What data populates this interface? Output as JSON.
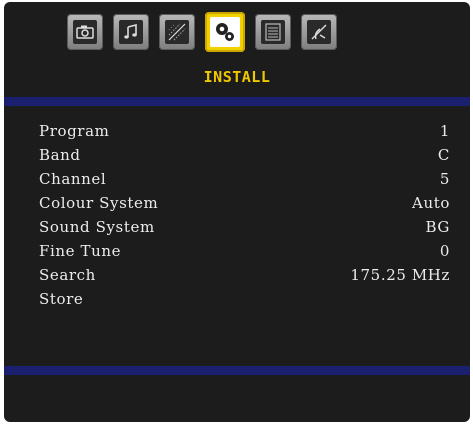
{
  "menu": {
    "tabs": [
      {
        "icon": "camera-icon"
      },
      {
        "icon": "music-note-icon"
      },
      {
        "icon": "picture-settings-icon"
      },
      {
        "icon": "gears-icon"
      },
      {
        "icon": "list-icon"
      },
      {
        "icon": "satellite-dish-icon"
      }
    ],
    "active_tab": 3,
    "title": "INSTALL"
  },
  "rows": [
    {
      "label": "Program",
      "value": "1"
    },
    {
      "label": "Band",
      "value": "C"
    },
    {
      "label": "Channel",
      "value": "5"
    },
    {
      "label": "Colour System",
      "value": "Auto"
    },
    {
      "label": "Sound System",
      "value": "BG"
    },
    {
      "label": "Fine Tune",
      "value": "0"
    },
    {
      "label": "Search",
      "value": "175.25 MHz"
    },
    {
      "label": "Store",
      "value": ""
    }
  ],
  "colors": {
    "background": "#1c1c1c",
    "band": "#1a1f70",
    "title": "#f0c800",
    "active_tab": "#f3d000",
    "text": "#ececec"
  }
}
